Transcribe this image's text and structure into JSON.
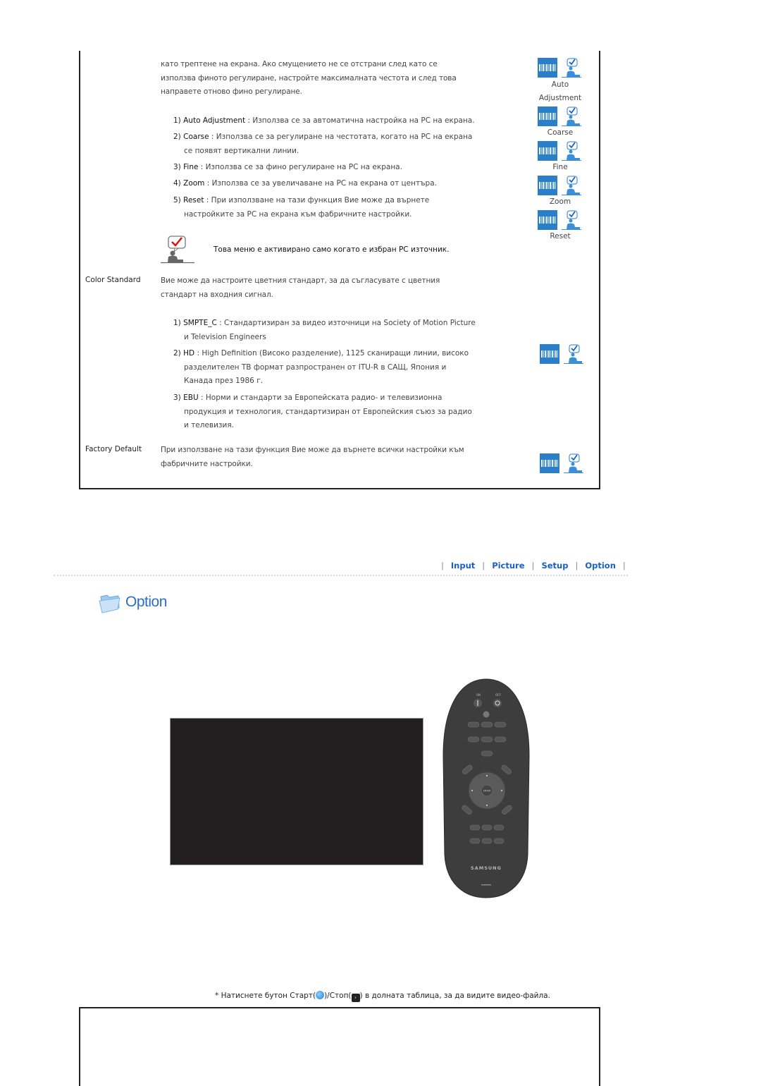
{
  "top_section": {
    "intro_lines": [
      "като трептене на екрана. Ако смущението не се отстрани след като се",
      "използва финото регулиране, настройте максималната честота и след това",
      "направете отново фино регулиране."
    ],
    "pc_items": [
      {
        "num": "1)",
        "keyword": "Auto Adjustment",
        "text": " : Използва се за автоматична настройка на PC на екрана.",
        "cont": ""
      },
      {
        "num": "2)",
        "keyword": "Coarse",
        "text": " : Използва се за регулиране на честотата, когато на PC на екрана",
        "cont": "се появят вертикални линии."
      },
      {
        "num": "3)",
        "keyword": "Fine",
        "text": " : Използва се за фино регулиране на PC на екрана.",
        "cont": ""
      },
      {
        "num": "4)",
        "keyword": "Zoom",
        "text": " : Използва се за увеличаване на PC на екрана от центъра.",
        "cont": ""
      },
      {
        "num": "5)",
        "keyword": "Reset",
        "text": " : При използване на тази функция Вие може да върнете",
        "cont": "настройките за PC на екрана към фабричните настройки."
      }
    ],
    "note": "Това меню е активирано само когато е избран PC източник.",
    "icon_captions": [
      "Auto",
      "Adjustment",
      "Coarse",
      "Fine",
      "Zoom",
      "Reset"
    ],
    "color_standard": {
      "label": "Color Standard",
      "desc_lines": [
        "Вие може да настроите цветния стандарт, за да съгласувате с цветния",
        "стандарт на входния сигнал."
      ],
      "items": [
        {
          "num": "1)",
          "keyword": "SMPTE_C",
          "text": " : Стандартизиран за видео източници на Society of Motion Picture",
          "cont": [
            "и Television Engineers"
          ]
        },
        {
          "num": "2)",
          "keyword": "HD",
          "text": " : High Definition (Високо разделение), 1125 сканиращи линии, високо",
          "cont": [
            "разделителен ТВ формат разпространен от ITU-R в САЩ, Япония и",
            "Канада през 1986 г."
          ]
        },
        {
          "num": "3)",
          "keyword": "EBU",
          "text": " : Норми и стандарти за Европейската радио- и телевизионна",
          "cont": [
            "продукция и технология, стандартизиран от Европейския съюз за радио",
            "и телевизия."
          ]
        }
      ]
    },
    "factory_default": {
      "label": "Factory Default",
      "desc_lines": [
        "При използване на тази функция Вие може да върнете всички настройки към",
        "фабричните настройки."
      ]
    }
  },
  "nav": {
    "links": [
      "Input",
      "Picture",
      "Setup",
      "Option"
    ],
    "separator": "|",
    "link_color": "#1a5fc7"
  },
  "section_title": "Option",
  "remote": {
    "brand": "SAMSUNG",
    "labels": {
      "on": "ON",
      "off": "OFF",
      "enter": "ENTER"
    }
  },
  "hint": {
    "prefix": "* Натиснете бутон Старт(",
    "middle": ")/Стоп(",
    "suffix": ") в долната таблица, за да видите видео-файла."
  },
  "colors": {
    "accent": "#2a7fc8",
    "video_bg": "#231f20",
    "remote_body": "#3d3d3d"
  }
}
